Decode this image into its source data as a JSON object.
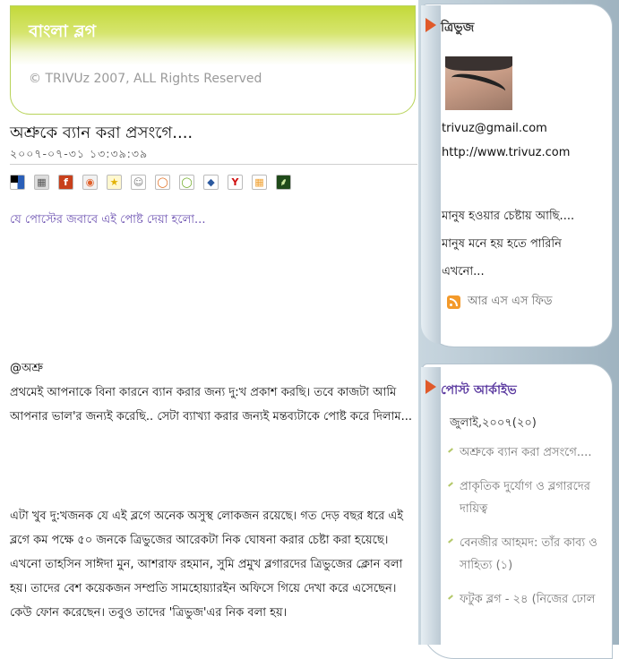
{
  "header": {
    "title": "বাংলা ব্লগ",
    "subtitle": "© TRIVUz 2007, ALL Rights Reserved"
  },
  "post": {
    "title": "অশ্রুকে ব্যান করা প্রসংগে....",
    "date": "২০০৭-০৭-৩১ ১৩:৩৯:৩৯",
    "share_icons": [
      {
        "icon": "delicious-icon",
        "glyph": "",
        "bg": "#ffffff",
        "fg": "#000"
      },
      {
        "icon": "digg-icon",
        "glyph": "▦",
        "bg": "#dddddd",
        "fg": "#555"
      },
      {
        "icon": "furl-icon",
        "glyph": "f",
        "bg": "#c8401c",
        "fg": "#fff"
      },
      {
        "icon": "blinklist-icon",
        "glyph": "◉",
        "bg": "#f2f2f2",
        "fg": "#e0602a"
      },
      {
        "icon": "star-icon",
        "glyph": "★",
        "bg": "#fff8d0",
        "fg": "#e2b100"
      },
      {
        "icon": "reddit-icon",
        "glyph": "☺",
        "bg": "#ffffff",
        "fg": "#777"
      },
      {
        "icon": "orange-circle-icon",
        "glyph": "◯",
        "bg": "#ffffff",
        "fg": "#e06a1a"
      },
      {
        "icon": "green-circle-icon",
        "glyph": "◯",
        "bg": "#ffffff",
        "fg": "#6aa81e"
      },
      {
        "icon": "ma-gnolia-icon",
        "glyph": "◆",
        "bg": "#ffffff",
        "fg": "#2c5aa0"
      },
      {
        "icon": "yahoo-icon",
        "glyph": "Y",
        "bg": "#ffffff",
        "fg": "#d01010"
      },
      {
        "icon": "grid-icon",
        "glyph": "▦",
        "bg": "#ffffff",
        "fg": "#f0a030"
      },
      {
        "icon": "wheat-icon",
        "glyph": "⸙",
        "bg": "#1f4a1a",
        "fg": "#cde8a0"
      }
    ],
    "reply_link": "যে পোস্টের জবাবে এই পোষ্ট দেয়া হলো...",
    "mention": "@অশ্রু",
    "paragraph1": "প্রথমেই আপনাকে বিনা কারনে ব্যান করার জন্য দু:খ প্রকাশ করছি। তবে কাজটা আমি আপনার ভাল'র জন্যই করেছি.. সেটা ব্যাখ্যা করার জন্যই মন্তব্যটাকে পোষ্ট করে দিলাম...",
    "paragraph2": "এটা খুব দু:খজনক যে এই ব্লগে অনেক অসুস্থ লোকজন রয়েছে। গত দেড় বছর ধরে এই ব্লগে কম পক্ষে ৫০ জনকে ত্রিভুজের আরেকটা নিক ঘোষনা করার চেষ্টা করা হয়েছে। এখনো তাহসিন সাঈদা মুন, আশরাফ রহমান, সুমি প্রমুখ ব্লগারদের ত্রিভুজের ক্লোন বলা হয়। তাদের বেশ কয়েকজন সম্প্রতি সামহোয়্যারইন অফিসে গিয়ে দেখা করে এসেছেন। কেউ ফোন করেছেন। তবুও তাদের 'ত্রিভুজ'এর নিক বলা হয়।"
  },
  "sidebar": {
    "profile": {
      "name": "ত্রিভুজ",
      "email": "trivuz@gmail.com",
      "url": "http://www.trivuz.com",
      "about_1": "মানুষ হওয়ার চেষ্টায় আছি....",
      "about_2": "মানুষ মনে হয় হতে পারিনি",
      "about_3": "এখনো...",
      "rss_label": "আর এস এস ফিড"
    },
    "archive": {
      "title": "পোস্ট আর্কাইভ",
      "month": "জুলাই,২০০৭(২০)",
      "posts": [
        "অশ্রুকে ব্যান করা প্রসংগে....",
        "প্রাকৃতিক দুর্যোগ ও ব্লগারদের দায়িত্ব",
        "বেনজীর আহমদ: তাঁর কাব্য ও সাহিত্য (১)",
        "ফটুক ব্লগ - ২৪ (নিজের ঢোল"
      ]
    }
  }
}
